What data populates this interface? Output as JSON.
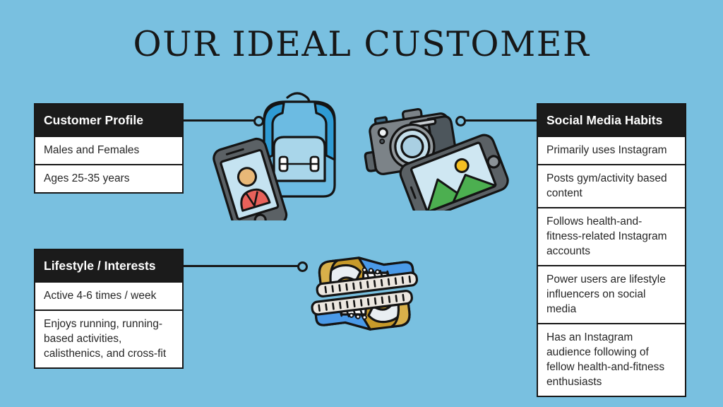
{
  "slide": {
    "title": "OUR IDEAL CUSTOMER",
    "background_color": "#79c0e0",
    "header_color": "#1b1b1b",
    "text_color": "#262626"
  },
  "cards": {
    "profile": {
      "header": "Customer Profile",
      "rows": [
        "Males and Females",
        "Ages 25-35 years"
      ]
    },
    "lifestyle": {
      "header": "Lifestyle / Interests",
      "rows": [
        "Active 4-6 times / week",
        "Enjoys running, running-based activities, calisthenics, and cross-fit"
      ]
    },
    "social": {
      "header": "Social Media Habits",
      "rows": [
        "Primarily uses Instagram",
        "Posts gym/activity based content",
        "Follows health-and-fitness-related Instagram accounts",
        "Power users are lifestyle influencers on social media",
        "Has an Instagram audience following of fellow health-and-fitness enthusiasts"
      ]
    }
  },
  "illustrations": [
    {
      "name": "backpack-and-phone-illustration",
      "colors": [
        "#5eb3dd",
        "#2e9bd4",
        "#a9d6ea",
        "#555a5e",
        "#e8615a",
        "#e8b878"
      ]
    },
    {
      "name": "camera-and-phone-illustration",
      "colors": [
        "#7c8388",
        "#565c61",
        "#c5dfeb",
        "#4caf50",
        "#f5c022"
      ]
    },
    {
      "name": "sneakers-illustration",
      "colors": [
        "#c79a2a",
        "#4a9ae8",
        "#e8e8e8",
        "#ffffff"
      ]
    }
  ],
  "connectors": [
    {
      "name": "connector-profile"
    },
    {
      "name": "connector-lifestyle"
    },
    {
      "name": "connector-social"
    }
  ]
}
